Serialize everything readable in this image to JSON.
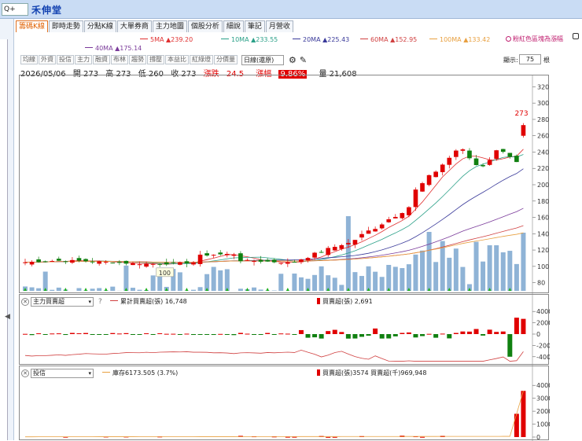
{
  "app": {
    "stock_name": "禾伸堂",
    "search_label": "Q+"
  },
  "tabs": [
    {
      "label": "籌碼K線",
      "active": true
    },
    {
      "label": "即時走勢"
    },
    {
      "label": "分點K線"
    },
    {
      "label": "大單券商"
    },
    {
      "label": "主力地圖"
    },
    {
      "label": "個股分析"
    },
    {
      "label": "細說"
    },
    {
      "label": "筆記"
    },
    {
      "label": "月營收"
    }
  ],
  "hint": "粉紅色區塊為漲幅",
  "ma_legend": [
    {
      "label": "5MA",
      "value": "▲239.20",
      "color": "#e03030"
    },
    {
      "label": "10MA",
      "value": "▲233.55",
      "color": "#2aa088"
    },
    {
      "label": "20MA",
      "value": "▲225.43",
      "color": "#3a3a9a"
    },
    {
      "label": "60MA",
      "value": "▲152.95",
      "color": "#d04040"
    },
    {
      "label": "100MA",
      "value": "▲133.42",
      "color": "#e8a040"
    },
    {
      "label": "40MA",
      "value": "▲175.14",
      "color": "#7a3a9a"
    }
  ],
  "toolbar": [
    "均線",
    "外資",
    "投信",
    "主力",
    "融資",
    "布林",
    "趨勢",
    "撐壓",
    "本益比",
    "紅綠燈",
    "分價量"
  ],
  "period": "日線(還原)",
  "show": {
    "label": "顯示:",
    "value": "75",
    "unit": "根"
  },
  "info": {
    "date": "2026/05/06",
    "open": "開 273",
    "high": "高 273",
    "low": "低 260",
    "close": "收 273",
    "change_label": "漲跌",
    "change": "24.5",
    "pct_label": "漲幅",
    "pct": "9.86%",
    "volume": "量 21,608"
  },
  "pane2": {
    "select": "主力買賣超",
    "question": "?",
    "legend1": "累計買賣超(張) 16,748",
    "legend2": "買賣超(張) 2,691"
  },
  "pane3": {
    "select": "投信",
    "legend1": "庫存6173.505 (3.7%)",
    "legend2": "買賣超(張)3574 買賣超(千)969,948"
  },
  "chart_data": [
    {
      "type": "candlestick",
      "y_axis_ticks": [
        80,
        100,
        120,
        140,
        160,
        180,
        200,
        220,
        240,
        260,
        280,
        300,
        320
      ],
      "ylim": [
        70,
        330
      ],
      "annotations": [
        {
          "label": "100"
        },
        {
          "label": "273"
        }
      ],
      "candles_count": 75,
      "last_candle": {
        "open": 260,
        "high": 273,
        "low": 260,
        "close": 273
      }
    },
    {
      "type": "bar",
      "y_axis_ticks": [
        -4000,
        -2000,
        0,
        2000,
        4000
      ],
      "ylim": [
        -5000,
        5000
      ],
      "series": [
        {
          "name": "累計買賣超(張)"
        },
        {
          "name": "買賣超(張)"
        }
      ]
    },
    {
      "type": "bar",
      "y_axis_ticks": [
        0,
        1000,
        2000,
        3000,
        4000
      ],
      "ylim": [
        0,
        4500
      ],
      "series": [
        {
          "name": "庫存"
        },
        {
          "name": "買賣超(張)"
        }
      ]
    }
  ]
}
